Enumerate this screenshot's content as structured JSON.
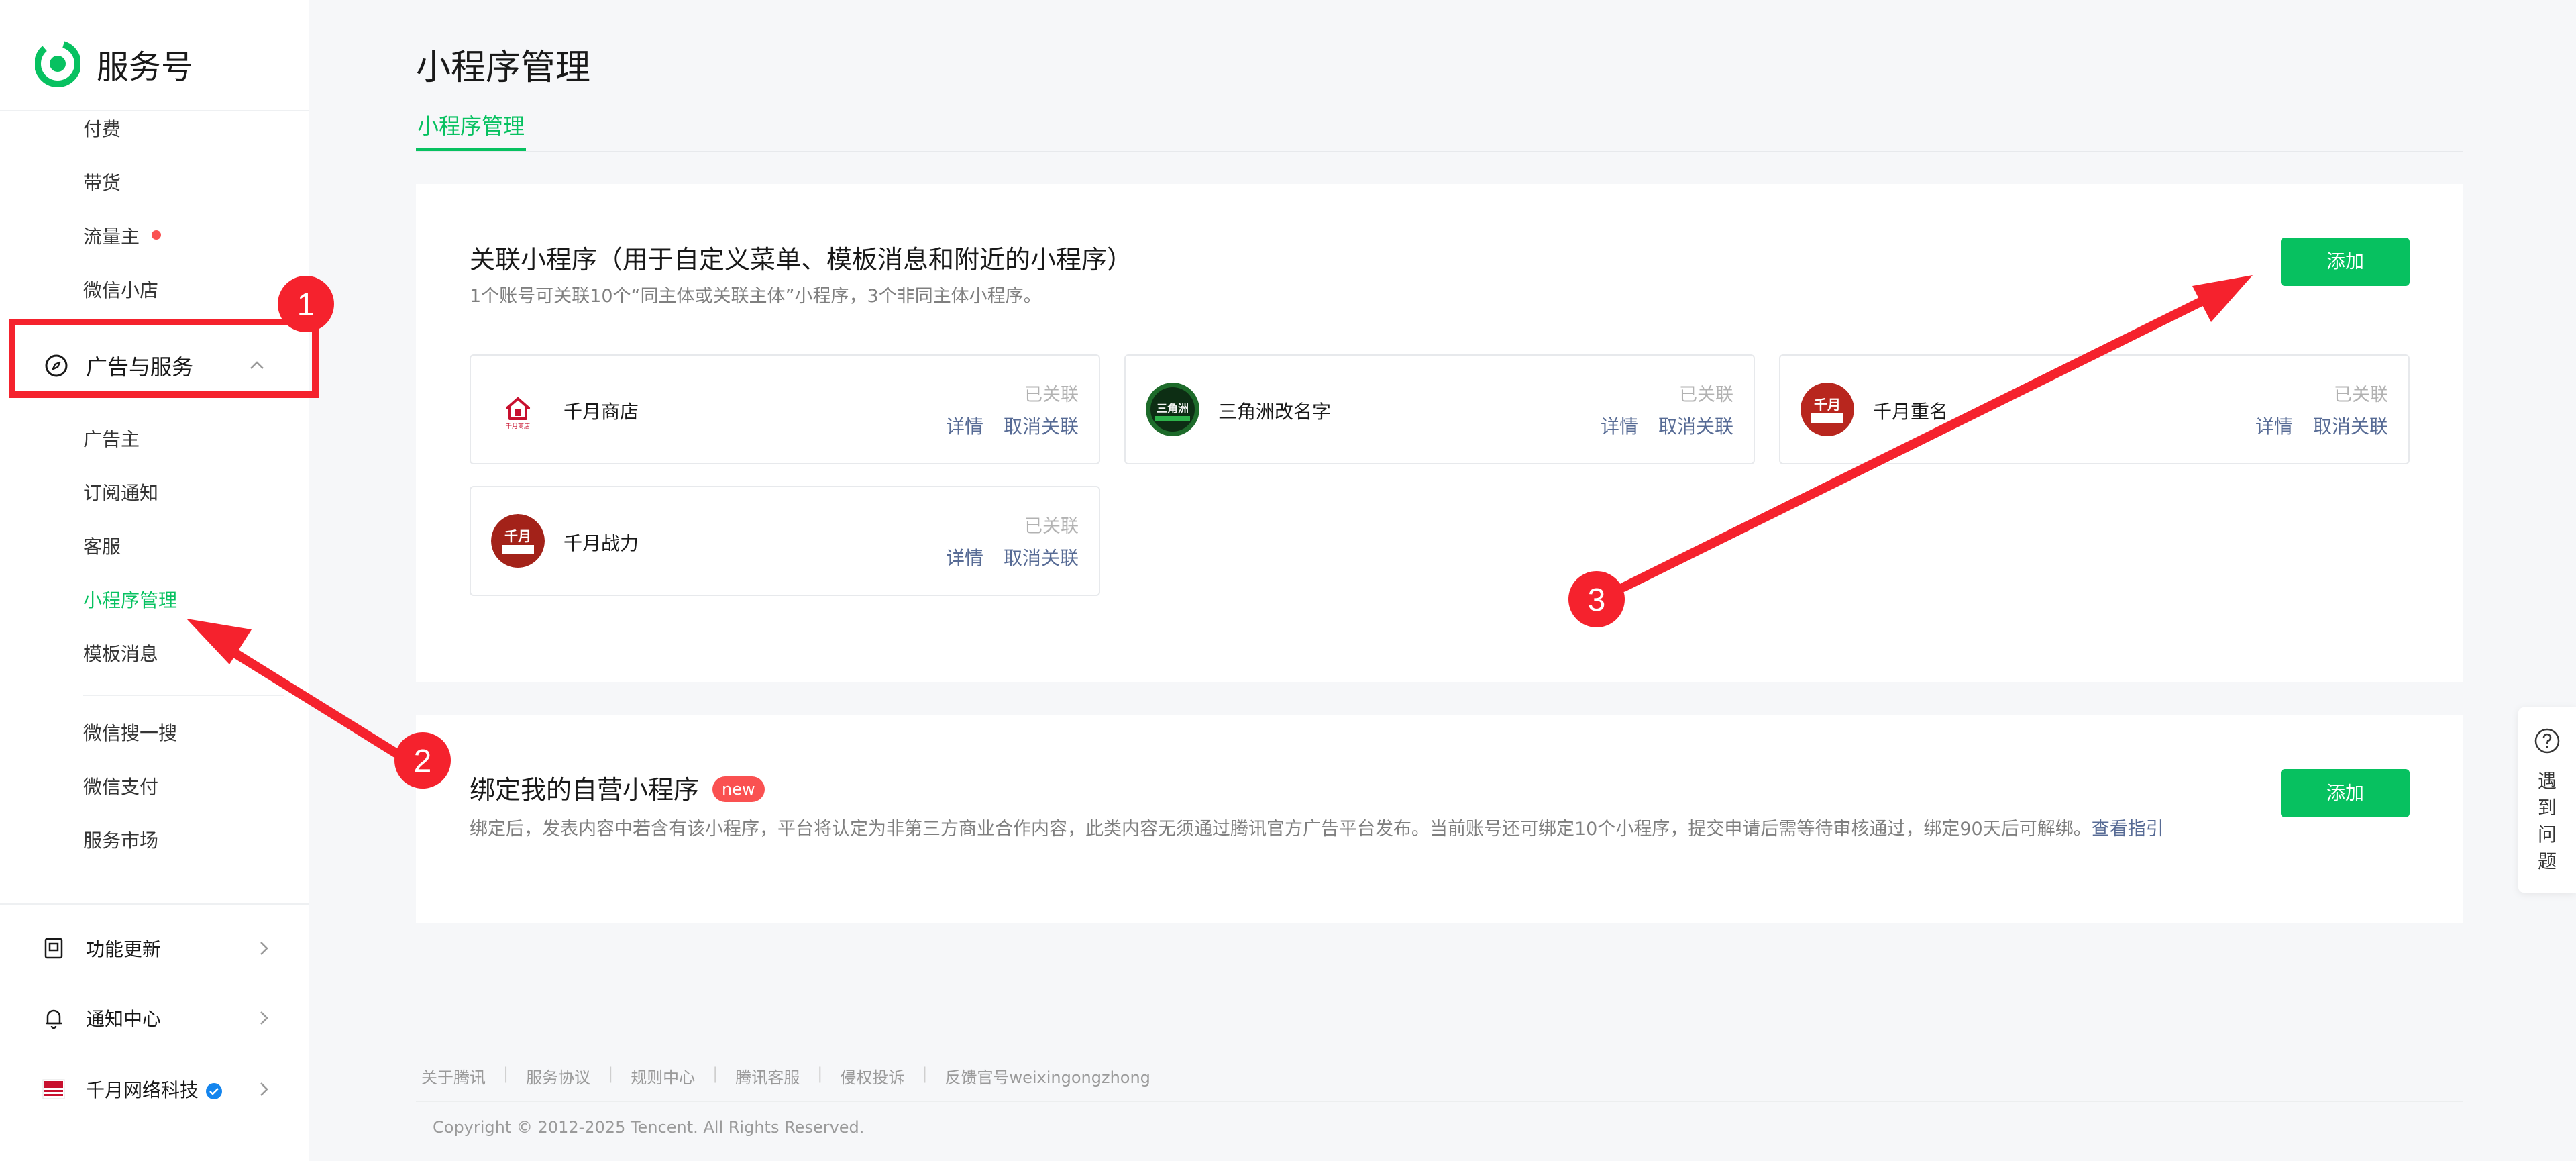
{
  "app": {
    "name": "服务号"
  },
  "sidebar": {
    "items_top": [
      {
        "label": "付费"
      },
      {
        "label": "带货"
      },
      {
        "label": "流量主",
        "dot": true
      },
      {
        "label": "微信小店"
      }
    ],
    "group": {
      "label": "广告与服务",
      "icon": "compass-icon",
      "expanded": true
    },
    "group_items": [
      {
        "label": "广告主"
      },
      {
        "label": "订阅通知"
      },
      {
        "label": "客服"
      },
      {
        "label": "小程序管理",
        "active": true
      },
      {
        "label": "模板消息"
      }
    ],
    "items_more": [
      {
        "label": "微信搜一搜"
      },
      {
        "label": "微信支付"
      },
      {
        "label": "服务市场"
      }
    ],
    "bottom": [
      {
        "label": "功能更新",
        "icon": "update-icon"
      },
      {
        "label": "通知中心",
        "icon": "bell-icon"
      },
      {
        "label": "千月网络科技",
        "icon": "account-avatar",
        "verified": true
      }
    ]
  },
  "main": {
    "title": "小程序管理",
    "tabs": [
      {
        "label": "小程序管理",
        "active": true
      }
    ],
    "linked_card": {
      "title": "关联小程序（用于自定义菜单、模板消息和附近的小程序）",
      "desc": "1个账号可关联10个“同主体或关联主体”小程序，3个非同主体小程序。",
      "add_label": "添加",
      "apps": [
        {
          "name": "千月商店",
          "status": "已关联",
          "detail": "详情",
          "unlink": "取消关联",
          "logo_text": "千月商店"
        },
        {
          "name": "三角洲改名字",
          "status": "已关联",
          "detail": "详情",
          "unlink": "取消关联",
          "logo_text": "三角洲"
        },
        {
          "name": "千月重名",
          "status": "已关联",
          "detail": "详情",
          "unlink": "取消关联",
          "logo_text": "千月"
        },
        {
          "name": "千月战力",
          "status": "已关联",
          "detail": "详情",
          "unlink": "取消关联",
          "logo_text": "千月"
        }
      ]
    },
    "own_card": {
      "title": "绑定我的自营小程序",
      "badge": "new",
      "desc": "绑定后，发表内容中若含有该小程序，平台将认定为非第三方商业合作内容，此类内容无须通过腾讯官方广告平台发布。当前账号还可绑定10个小程序，提交申请后需等待审核通过，绑定90天后可解绑。",
      "desc_link": "查看指引",
      "add_label": "添加"
    }
  },
  "footer": {
    "links": [
      "关于腾讯",
      "服务协议",
      "规则中心",
      "腾讯客服",
      "侵权投诉",
      "反馈官号weixingongzhong"
    ],
    "copyright": "Copyright © 2012-2025 Tencent. All Rights Reserved."
  },
  "help": {
    "label": "遇到问题"
  },
  "annotations": [
    {
      "number": "1"
    },
    {
      "number": "2"
    },
    {
      "number": "3"
    }
  ],
  "colors": {
    "brand": "#07c160",
    "link": "#576b95",
    "danger": "#fa5151",
    "annotation": "#f5222d"
  }
}
